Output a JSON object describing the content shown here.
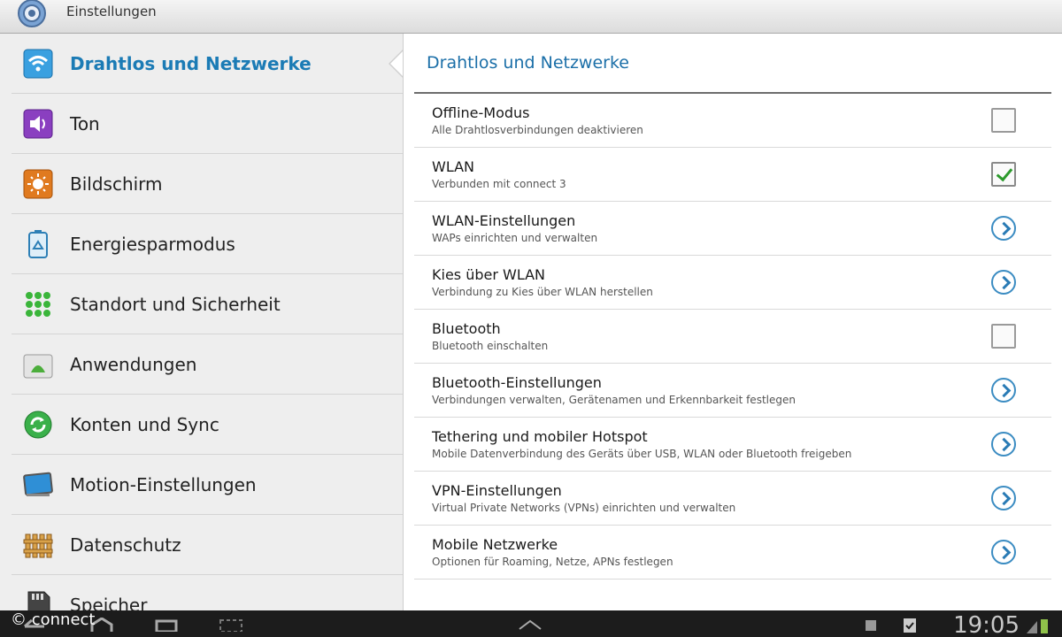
{
  "window": {
    "title": "Einstellungen"
  },
  "sidebar": {
    "items": [
      {
        "label": "Drahtlos und Netzwerke",
        "icon": "wifi-icon",
        "selected": true
      },
      {
        "label": "Ton",
        "icon": "speaker-icon"
      },
      {
        "label": "Bildschirm",
        "icon": "brightness-icon"
      },
      {
        "label": "Energiesparmodus",
        "icon": "battery-recycle-icon"
      },
      {
        "label": "Standort und Sicherheit",
        "icon": "location-grid-icon"
      },
      {
        "label": "Anwendungen",
        "icon": "android-apps-icon"
      },
      {
        "label": "Konten und Sync",
        "icon": "sync-icon"
      },
      {
        "label": "Motion-Einstellungen",
        "icon": "motion-screen-icon"
      },
      {
        "label": "Datenschutz",
        "icon": "fence-icon"
      },
      {
        "label": "Speicher",
        "icon": "sdcard-icon"
      }
    ]
  },
  "main": {
    "title": "Drahtlos und Netzwerke",
    "rows": [
      {
        "title": "Offline-Modus",
        "subtitle": "Alle Drahtlosverbindungen deaktivieren",
        "control": "checkbox",
        "checked": false
      },
      {
        "title": "WLAN",
        "subtitle": "Verbunden mit connect 3",
        "control": "checkbox",
        "checked": true
      },
      {
        "title": "WLAN-Einstellungen",
        "subtitle": "WAPs einrichten und verwalten",
        "control": "arrow"
      },
      {
        "title": "Kies über WLAN",
        "subtitle": "Verbindung zu Kies über WLAN herstellen",
        "control": "arrow"
      },
      {
        "title": "Bluetooth",
        "subtitle": "Bluetooth einschalten",
        "control": "checkbox",
        "checked": false
      },
      {
        "title": "Bluetooth-Einstellungen",
        "subtitle": "Verbindungen verwalten, Gerätenamen und Erkennbarkeit festlegen",
        "control": "arrow"
      },
      {
        "title": "Tethering und mobiler Hotspot",
        "subtitle": "Mobile Datenverbindung des Geräts über USB, WLAN oder Bluetooth freigeben",
        "control": "arrow"
      },
      {
        "title": "VPN-Einstellungen",
        "subtitle": "Virtual Private Networks (VPNs) einrichten und verwalten",
        "control": "arrow"
      },
      {
        "title": "Mobile Netzwerke",
        "subtitle": "Optionen für Roaming, Netze, APNs festlegen",
        "control": "arrow"
      }
    ]
  },
  "statusbar": {
    "watermark": "© connect",
    "clock": "19:05"
  },
  "colors": {
    "accent": "#1b7bb5",
    "check": "#2c9a2c",
    "navbar": "#1c1c1c"
  }
}
